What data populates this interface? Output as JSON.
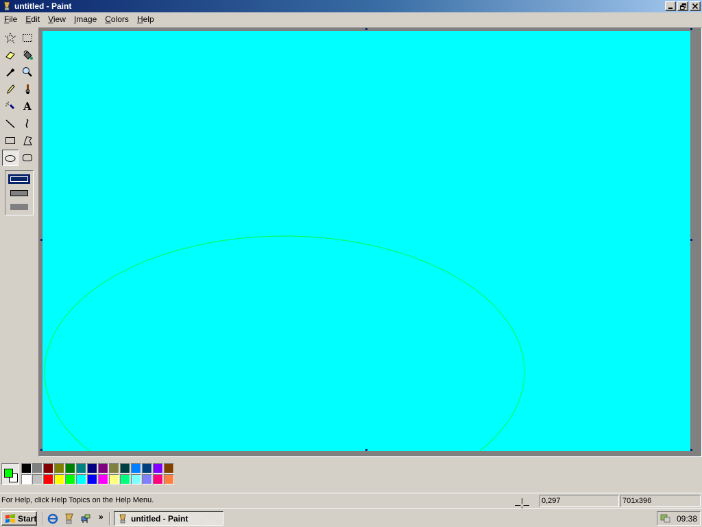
{
  "window": {
    "title": "untitled - Paint"
  },
  "menu": [
    {
      "accel": "F",
      "rest": "ile"
    },
    {
      "accel": "E",
      "rest": "dit"
    },
    {
      "accel": "V",
      "rest": "iew"
    },
    {
      "accel": "I",
      "rest": "mage"
    },
    {
      "accel": "C",
      "rest": "olors"
    },
    {
      "accel": "H",
      "rest": "elp"
    }
  ],
  "tools": [
    {
      "name": "free-form-select-tool",
      "icon": "star-select-icon"
    },
    {
      "name": "select-tool",
      "icon": "rect-select-icon"
    },
    {
      "name": "eraser-tool",
      "icon": "eraser-icon"
    },
    {
      "name": "fill-tool",
      "icon": "paint-bucket-icon"
    },
    {
      "name": "pick-color-tool",
      "icon": "eyedropper-icon"
    },
    {
      "name": "magnifier-tool",
      "icon": "magnifier-icon"
    },
    {
      "name": "pencil-tool",
      "icon": "pencil-icon"
    },
    {
      "name": "brush-tool",
      "icon": "brush-icon"
    },
    {
      "name": "airbrush-tool",
      "icon": "airbrush-icon"
    },
    {
      "name": "text-tool",
      "icon": "text-icon"
    },
    {
      "name": "line-tool",
      "icon": "line-icon"
    },
    {
      "name": "curve-tool",
      "icon": "curve-icon"
    },
    {
      "name": "rectangle-tool",
      "icon": "rectangle-icon"
    },
    {
      "name": "polygon-tool",
      "icon": "polygon-icon"
    },
    {
      "name": "ellipse-tool",
      "icon": "ellipse-icon",
      "selected": true
    },
    {
      "name": "rounded-rectangle-tool",
      "icon": "rounded-rect-icon"
    }
  ],
  "text_tool_glyph": "A",
  "canvas": {
    "background": "#00ffff",
    "ellipse_stroke": "#00ff66"
  },
  "current_colors": {
    "foreground": "#00ff00",
    "background": "#ffffff"
  },
  "palette": {
    "row1": [
      "#000000",
      "#808080",
      "#800000",
      "#808000",
      "#008000",
      "#008080",
      "#000080",
      "#800080",
      "#808040",
      "#004040",
      "#0080ff",
      "#004080",
      "#8000ff",
      "#804000"
    ],
    "row2": [
      "#ffffff",
      "#c0c0c0",
      "#ff0000",
      "#ffff00",
      "#00ff00",
      "#00ffff",
      "#0000ff",
      "#ff00ff",
      "#ffff80",
      "#00ff80",
      "#80ffff",
      "#8080ff",
      "#ff0080",
      "#ff8040"
    ]
  },
  "status": {
    "help_text": "For Help, click Help Topics on the Help Menu.",
    "coords": "0,297",
    "size": "701x396"
  },
  "taskbar": {
    "start_label": "Start",
    "chevron": "»",
    "task_label": "untitled - Paint",
    "clock": "09:38"
  }
}
